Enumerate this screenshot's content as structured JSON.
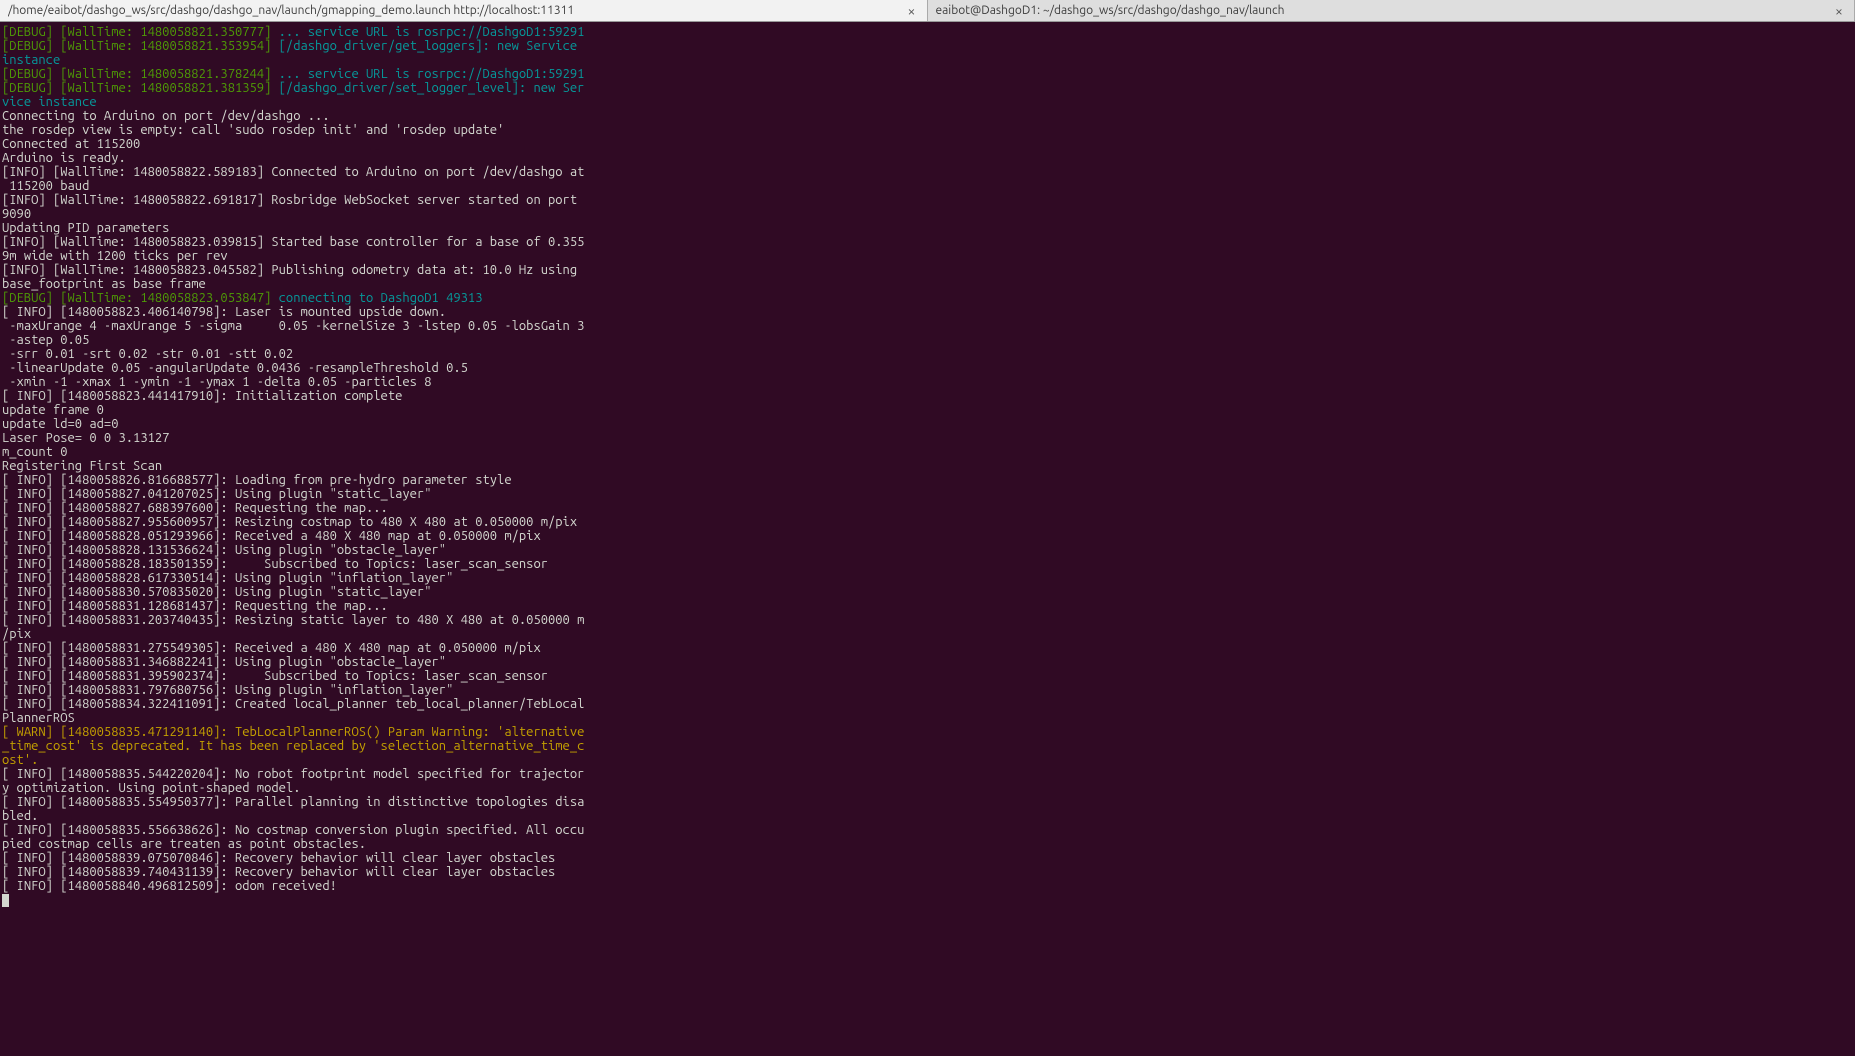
{
  "tabs": [
    {
      "title": "/home/eaibot/dashgo_ws/src/dashgo/dashgo_nav/launch/gmapping_demo.launch http://localhost:11311",
      "active": true
    },
    {
      "title": "eaibot@DashgoD1: ~/dashgo_ws/src/dashgo/dashgo_nav/launch",
      "active": false
    }
  ],
  "close_glyph": "×",
  "lines": [
    {
      "segments": [
        {
          "cls": "debug-tag",
          "t": "[DEBUG]"
        },
        {
          "cls": "plain",
          "t": " "
        },
        {
          "cls": "debug-time",
          "t": "[WallTime: 1480058821.350777]"
        },
        {
          "cls": "plain",
          "t": " "
        },
        {
          "cls": "debug-msg",
          "t": "... service URL is rosrpc://DashgoD1:59291"
        }
      ]
    },
    {
      "segments": [
        {
          "cls": "debug-tag",
          "t": "[DEBUG]"
        },
        {
          "cls": "plain",
          "t": " "
        },
        {
          "cls": "debug-time",
          "t": "[WallTime: 1480058821.353954]"
        },
        {
          "cls": "plain",
          "t": " "
        },
        {
          "cls": "debug-msg",
          "t": "[/dashgo_driver/get_loggers]: new Service instance"
        }
      ]
    },
    {
      "segments": [
        {
          "cls": "debug-tag",
          "t": "[DEBUG]"
        },
        {
          "cls": "plain",
          "t": " "
        },
        {
          "cls": "debug-time",
          "t": "[WallTime: 1480058821.378244]"
        },
        {
          "cls": "plain",
          "t": " "
        },
        {
          "cls": "debug-msg",
          "t": "... service URL is rosrpc://DashgoD1:59291"
        }
      ]
    },
    {
      "segments": [
        {
          "cls": "debug-tag",
          "t": "[DEBUG]"
        },
        {
          "cls": "plain",
          "t": " "
        },
        {
          "cls": "debug-time",
          "t": "[WallTime: 1480058821.381359]"
        },
        {
          "cls": "plain",
          "t": " "
        },
        {
          "cls": "debug-msg",
          "t": "[/dashgo_driver/set_logger_level]: new Service instance"
        }
      ]
    },
    {
      "segments": [
        {
          "cls": "plain",
          "t": "Connecting to Arduino on port /dev/dashgo ..."
        }
      ]
    },
    {
      "segments": [
        {
          "cls": "plain",
          "t": "the rosdep view is empty: call 'sudo rosdep init' and 'rosdep update'"
        }
      ]
    },
    {
      "segments": [
        {
          "cls": "plain",
          "t": "Connected at 115200"
        }
      ]
    },
    {
      "segments": [
        {
          "cls": "plain",
          "t": "Arduino is ready."
        }
      ]
    },
    {
      "segments": [
        {
          "cls": "plain",
          "t": "[INFO] [WallTime: 1480058822.589183] Connected to Arduino on port /dev/dashgo at 115200 baud"
        }
      ]
    },
    {
      "segments": [
        {
          "cls": "plain",
          "t": "[INFO] [WallTime: 1480058822.691817] Rosbridge WebSocket server started on port 9090"
        }
      ]
    },
    {
      "segments": [
        {
          "cls": "plain",
          "t": "Updating PID parameters"
        }
      ]
    },
    {
      "segments": [
        {
          "cls": "plain",
          "t": "[INFO] [WallTime: 1480058823.039815] Started base controller for a base of 0.3559m wide with 1200 ticks per rev"
        }
      ]
    },
    {
      "segments": [
        {
          "cls": "plain",
          "t": "[INFO] [WallTime: 1480058823.045582] Publishing odometry data at: 10.0 Hz using base_footprint as base frame"
        }
      ]
    },
    {
      "segments": [
        {
          "cls": "debug-tag",
          "t": "[DEBUG]"
        },
        {
          "cls": "plain",
          "t": " "
        },
        {
          "cls": "debug-time",
          "t": "[WallTime: 1480058823.053847]"
        },
        {
          "cls": "plain",
          "t": " "
        },
        {
          "cls": "debug-msg",
          "t": "connecting to DashgoD1 49313"
        }
      ]
    },
    {
      "segments": [
        {
          "cls": "plain",
          "t": "[ INFO] [1480058823.406140798]: Laser is mounted upside down."
        }
      ]
    },
    {
      "segments": [
        {
          "cls": "plain",
          "t": " -maxUrange 4 -maxUrange 5 -sigma     0.05 -kernelSize 3 -lstep 0.05 -lobsGain 3 -astep 0.05"
        }
      ]
    },
    {
      "segments": [
        {
          "cls": "plain",
          "t": " -srr 0.01 -srt 0.02 -str 0.01 -stt 0.02"
        }
      ]
    },
    {
      "segments": [
        {
          "cls": "plain",
          "t": " -linearUpdate 0.05 -angularUpdate 0.0436 -resampleThreshold 0.5"
        }
      ]
    },
    {
      "segments": [
        {
          "cls": "plain",
          "t": " -xmin -1 -xmax 1 -ymin -1 -ymax 1 -delta 0.05 -particles 8"
        }
      ]
    },
    {
      "segments": [
        {
          "cls": "plain",
          "t": "[ INFO] [1480058823.441417910]: Initialization complete"
        }
      ]
    },
    {
      "segments": [
        {
          "cls": "plain",
          "t": "update frame 0"
        }
      ]
    },
    {
      "segments": [
        {
          "cls": "plain",
          "t": "update ld=0 ad=0"
        }
      ]
    },
    {
      "segments": [
        {
          "cls": "plain",
          "t": "Laser Pose= 0 0 3.13127"
        }
      ]
    },
    {
      "segments": [
        {
          "cls": "plain",
          "t": "m_count 0"
        }
      ]
    },
    {
      "segments": [
        {
          "cls": "plain",
          "t": "Registering First Scan"
        }
      ]
    },
    {
      "segments": [
        {
          "cls": "plain",
          "t": "[ INFO] [1480058826.816688577]: Loading from pre-hydro parameter style"
        }
      ]
    },
    {
      "segments": [
        {
          "cls": "plain",
          "t": "[ INFO] [1480058827.041207025]: Using plugin \"static_layer\""
        }
      ]
    },
    {
      "segments": [
        {
          "cls": "plain",
          "t": "[ INFO] [1480058827.688397600]: Requesting the map..."
        }
      ]
    },
    {
      "segments": [
        {
          "cls": "plain",
          "t": "[ INFO] [1480058827.955600957]: Resizing costmap to 480 X 480 at 0.050000 m/pix"
        }
      ]
    },
    {
      "segments": [
        {
          "cls": "plain",
          "t": "[ INFO] [1480058828.051293966]: Received a 480 X 480 map at 0.050000 m/pix"
        }
      ]
    },
    {
      "segments": [
        {
          "cls": "plain",
          "t": "[ INFO] [1480058828.131536624]: Using plugin \"obstacle_layer\""
        }
      ]
    },
    {
      "segments": [
        {
          "cls": "plain",
          "t": "[ INFO] [1480058828.183501359]:     Subscribed to Topics: laser_scan_sensor"
        }
      ]
    },
    {
      "segments": [
        {
          "cls": "plain",
          "t": "[ INFO] [1480058828.617330514]: Using plugin \"inflation_layer\""
        }
      ]
    },
    {
      "segments": [
        {
          "cls": "plain",
          "t": "[ INFO] [1480058830.570835020]: Using plugin \"static_layer\""
        }
      ]
    },
    {
      "segments": [
        {
          "cls": "plain",
          "t": "[ INFO] [1480058831.128681437]: Requesting the map..."
        }
      ]
    },
    {
      "segments": [
        {
          "cls": "plain",
          "t": "[ INFO] [1480058831.203740435]: Resizing static layer to 480 X 480 at 0.050000 m/pix"
        }
      ]
    },
    {
      "segments": [
        {
          "cls": "plain",
          "t": "[ INFO] [1480058831.275549305]: Received a 480 X 480 map at 0.050000 m/pix"
        }
      ]
    },
    {
      "segments": [
        {
          "cls": "plain",
          "t": "[ INFO] [1480058831.346882241]: Using plugin \"obstacle_layer\""
        }
      ]
    },
    {
      "segments": [
        {
          "cls": "plain",
          "t": "[ INFO] [1480058831.395902374]:     Subscribed to Topics: laser_scan_sensor"
        }
      ]
    },
    {
      "segments": [
        {
          "cls": "plain",
          "t": "[ INFO] [1480058831.797680756]: Using plugin \"inflation_layer\""
        }
      ]
    },
    {
      "segments": [
        {
          "cls": "plain",
          "t": "[ INFO] [1480058834.322411091]: Created local_planner teb_local_planner/TebLocalPlannerROS"
        }
      ]
    },
    {
      "segments": [
        {
          "cls": "warn",
          "t": "[ WARN] [1480058835.471291140]: TebLocalPlannerROS() Param Warning: 'alternative_time_cost' is deprecated. It has been replaced by 'selection_alternative_time_cost'."
        }
      ]
    },
    {
      "segments": [
        {
          "cls": "plain",
          "t": "[ INFO] [1480058835.544220204]: No robot footprint model specified for trajectory optimization. Using point-shaped model."
        }
      ]
    },
    {
      "segments": [
        {
          "cls": "plain",
          "t": "[ INFO] [1480058835.554950377]: Parallel planning in distinctive topologies disabled."
        }
      ]
    },
    {
      "segments": [
        {
          "cls": "plain",
          "t": "[ INFO] [1480058835.556638626]: No costmap conversion plugin specified. All occupied costmap cells are treaten as point obstacles."
        }
      ]
    },
    {
      "segments": [
        {
          "cls": "plain",
          "t": "[ INFO] [1480058839.075070846]: Recovery behavior will clear layer obstacles"
        }
      ]
    },
    {
      "segments": [
        {
          "cls": "plain",
          "t": "[ INFO] [1480058839.740431139]: Recovery behavior will clear layer obstacles"
        }
      ]
    },
    {
      "segments": [
        {
          "cls": "plain",
          "t": "[ INFO] [1480058840.496812509]: odom received!"
        }
      ]
    }
  ]
}
